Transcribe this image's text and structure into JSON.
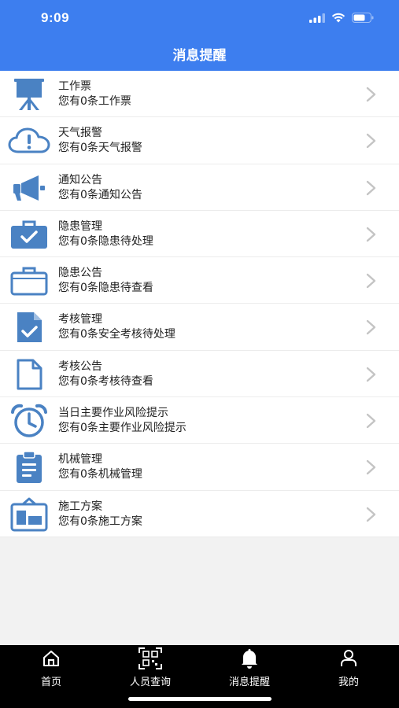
{
  "status_bar": {
    "time": "9:09"
  },
  "header": {
    "title": "消息提醒"
  },
  "colors": {
    "accent": "#3d7eef",
    "icon": "#4a82c3",
    "tabbar": "#000000"
  },
  "list": [
    {
      "title": "工作票",
      "subtitle": "您有0条工作票",
      "icon": "presentation-board-icon"
    },
    {
      "title": "天气报警",
      "subtitle": "您有0条天气报警",
      "icon": "cloud-alert-icon"
    },
    {
      "title": "通知公告",
      "subtitle": "您有0条通知公告",
      "icon": "megaphone-icon"
    },
    {
      "title": "隐患管理",
      "subtitle": "您有0条隐患待处理",
      "icon": "briefcase-check-icon"
    },
    {
      "title": "隐患公告",
      "subtitle": "您有0条隐患待查看",
      "icon": "briefcase-icon"
    },
    {
      "title": "考核管理",
      "subtitle": "您有0条安全考核待处理",
      "icon": "document-check-icon"
    },
    {
      "title": "考核公告",
      "subtitle": "您有0条考核待查看",
      "icon": "document-icon"
    },
    {
      "title": "当日主要作业风险提示",
      "subtitle": "您有0条主要作业风险提示",
      "icon": "alarm-clock-icon"
    },
    {
      "title": "机械管理",
      "subtitle": "您有0条机械管理",
      "icon": "clipboard-icon"
    },
    {
      "title": "施工方案",
      "subtitle": "您有0条施工方案",
      "icon": "construction-plan-icon"
    }
  ],
  "tabs": [
    {
      "label": "首页",
      "icon": "home-icon"
    },
    {
      "label": "人员查询",
      "icon": "qr-scan-icon"
    },
    {
      "label": "消息提醒",
      "icon": "bell-icon"
    },
    {
      "label": "我的",
      "icon": "user-icon"
    }
  ]
}
